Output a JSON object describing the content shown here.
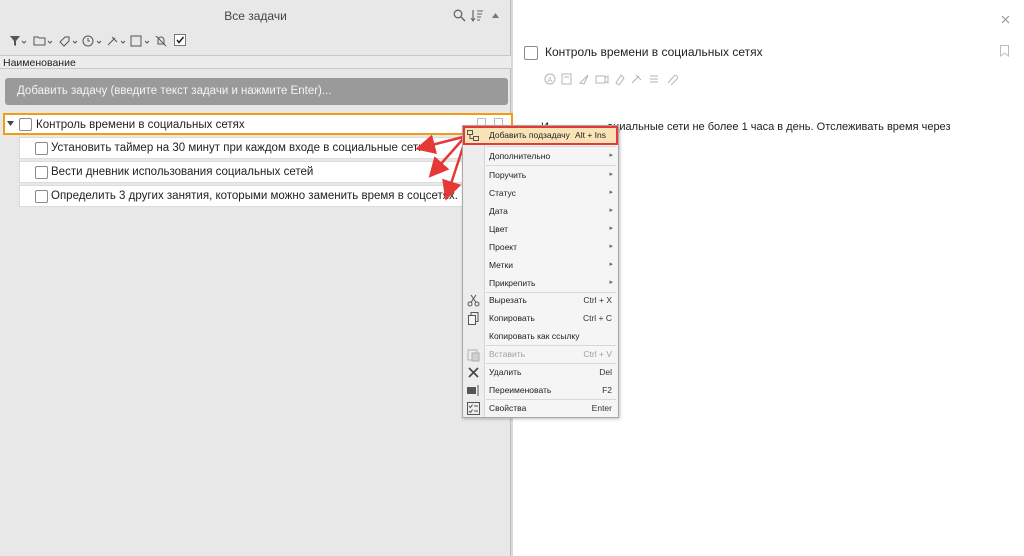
{
  "left_panel": {
    "title": "Все задачи",
    "column_header": "Наименование",
    "add_task_placeholder": "Добавить задачу (введите текст задачи и нажмите Enter)..."
  },
  "tasks": {
    "main": "Контроль времени в социальных сетях",
    "subtasks": [
      "Установить таймер на 30 минут при каждом входе в социальные сети",
      "Вести дневник использования социальных сетей",
      "Определить 3 других занятия, которыми можно заменить время в соцсетях."
    ]
  },
  "right_panel": {
    "task_title": "Контроль времени в социальных сетях",
    "description": "И                   оциальные сети не более 1 часа в день. Отслеживать время через"
  },
  "context_menu": {
    "items": [
      {
        "label": "Добавить подзадачу",
        "shortcut": "Alt + Ins",
        "icon": "add-subtask-icon",
        "highlighted": true
      },
      {
        "label": "Дополнительно",
        "submenu": true
      },
      {
        "label": "Поручить",
        "submenu": true
      },
      {
        "label": "Статус",
        "submenu": true
      },
      {
        "label": "Дата",
        "submenu": true
      },
      {
        "label": "Цвет",
        "submenu": true
      },
      {
        "label": "Проект",
        "submenu": true
      },
      {
        "label": "Метки",
        "submenu": true
      },
      {
        "label": "Прикрепить",
        "submenu": true
      },
      {
        "label": "Вырезать",
        "shortcut": "Ctrl + X",
        "icon": "scissors-icon"
      },
      {
        "label": "Копировать",
        "shortcut": "Ctrl + C",
        "icon": "copy-icon"
      },
      {
        "label": "Копировать как ссылку"
      },
      {
        "label": "Вставить",
        "shortcut": "Ctrl + V",
        "icon": "paste-icon",
        "disabled": true
      },
      {
        "label": "Удалить",
        "shortcut": "Del",
        "icon": "delete-icon"
      },
      {
        "label": "Переименовать",
        "shortcut": "F2",
        "icon": "rename-icon"
      },
      {
        "label": "Свойства",
        "shortcut": "Enter",
        "icon": "properties-icon"
      }
    ],
    "submenu_arrow": "▸"
  },
  "colors": {
    "highlight_border": "#e53935",
    "task_selected_border": "#f39c12",
    "annotation_arrow": "#e53935"
  }
}
